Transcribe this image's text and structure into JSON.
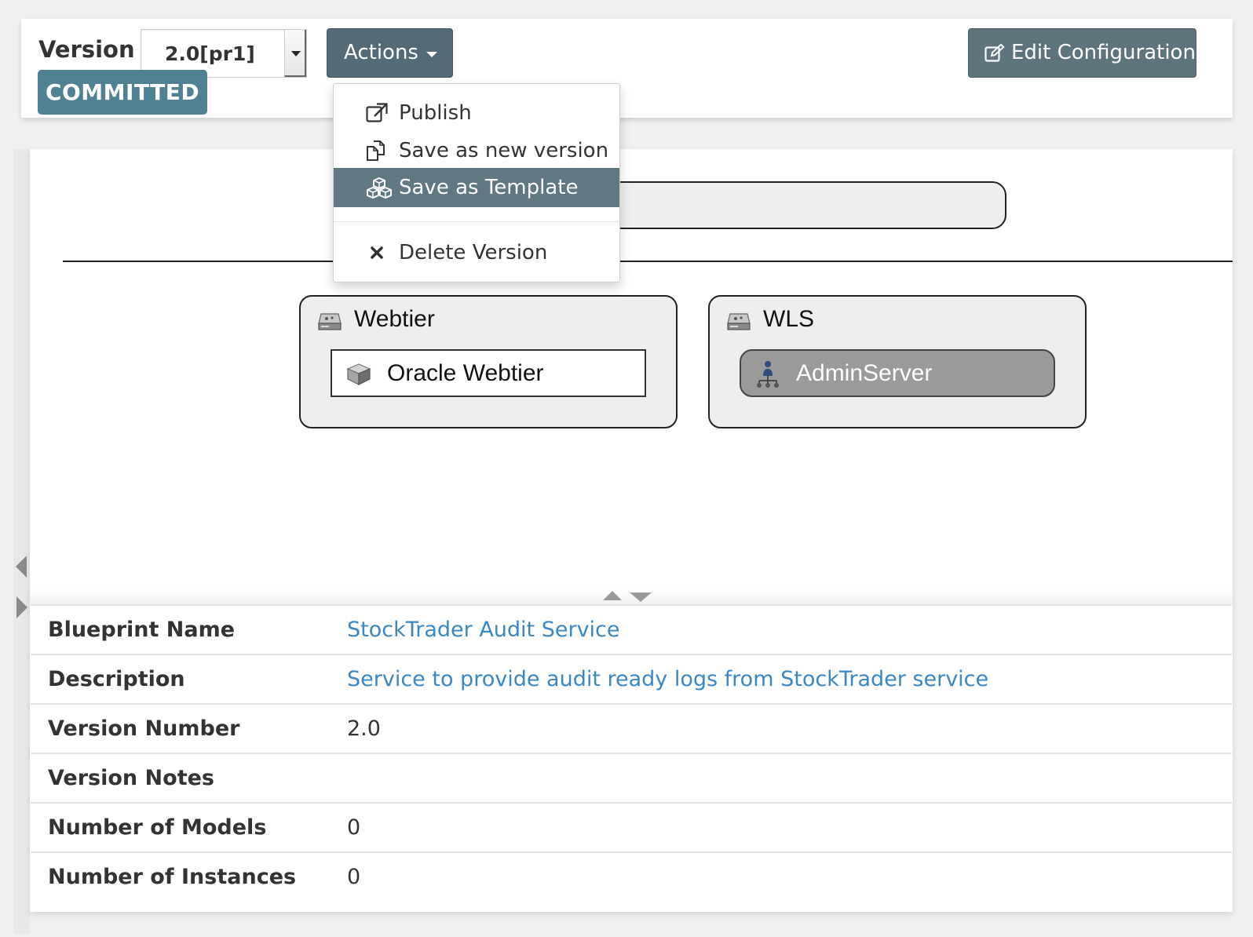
{
  "toolbar": {
    "version_label": "Version",
    "version_value": "2.0[pr1]",
    "status_badge": "COMMITTED",
    "actions_label": "Actions",
    "edit_config_label": "Edit Configuration"
  },
  "actions_menu": {
    "items": [
      {
        "label": "Publish",
        "icon": "external-link-icon"
      },
      {
        "label": "Save as new version",
        "icon": "copy-icon"
      },
      {
        "label": "Save as Template",
        "icon": "cubes-icon",
        "active": true
      },
      {
        "label": "Delete Version",
        "icon": "close-icon"
      }
    ]
  },
  "diagram": {
    "tiers": [
      {
        "title": "Webtier",
        "node": "Oracle Webtier"
      },
      {
        "title": "WLS",
        "node": "AdminServer"
      }
    ]
  },
  "details": {
    "rows": [
      {
        "key": "Blueprint Name",
        "value": "StockTrader Audit Service"
      },
      {
        "key": "Description",
        "value": "Service to provide audit ready logs from StockTrader service"
      },
      {
        "key": "Version Number",
        "value": "2.0"
      },
      {
        "key": "Version Notes",
        "value": ""
      },
      {
        "key": "Number of Models",
        "value": "0"
      },
      {
        "key": "Number of Instances",
        "value": "0"
      }
    ]
  },
  "colors": {
    "badge": "#4f8193",
    "actions_button": "#526b76",
    "edit_button": "#5e747d",
    "menu_active": "#607882",
    "link": "#3b87c4"
  }
}
